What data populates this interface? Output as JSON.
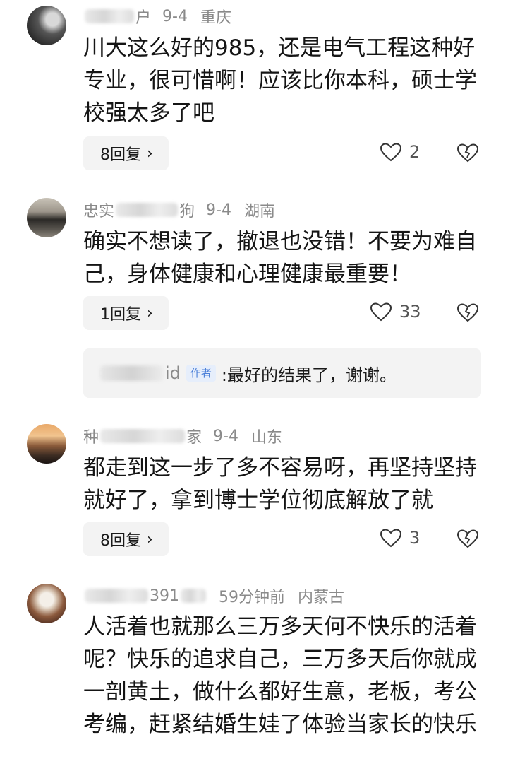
{
  "comments": [
    {
      "name_visible": "户",
      "date": "9-4",
      "location": "重庆",
      "text": "川大这么好的985，还是电气工程这种好专业，很可惜啊！应该比你本科，硕士学校强太多了吧",
      "replies_label": "8回复",
      "likes": "2"
    },
    {
      "name_visible": "忠实",
      "name_visible_2": "狗",
      "date": "9-4",
      "location": "湖南",
      "text": "确实不想读了，撤退也没错！不要为难自己，身体健康和心理健康最重要！",
      "replies_label": "1回复",
      "likes": "33",
      "author_reply": {
        "name_visible": "id",
        "badge": "作者",
        "text": ":最好的结果了，谢谢。"
      }
    },
    {
      "name_visible": "种",
      "name_visible_2": "家",
      "date": "9-4",
      "location": "山东",
      "text": "都走到这一步了多不容易呀，再坚持坚持就好了，拿到博士学位彻底解放了就",
      "replies_label": "8回复",
      "likes": "3"
    },
    {
      "name_visible": "391",
      "date": "59分钟前",
      "location": "内蒙古",
      "text": "人活着也就那么三万多天何不快乐的活着呢？快乐的追求自己，三万多天后你就成一剖黄土，做什么都好生意，老板，考公 考编，赶紧结婚生娃了体验当家长的快乐"
    }
  ],
  "icons": {
    "like": "heart-icon",
    "dislike": "broken-heart-icon",
    "chevron": "chevron-right-icon"
  },
  "colors": {
    "meta": "#8a8a8a",
    "badge": "#4a7fd8",
    "pill_bg": "#f3f3f3"
  }
}
